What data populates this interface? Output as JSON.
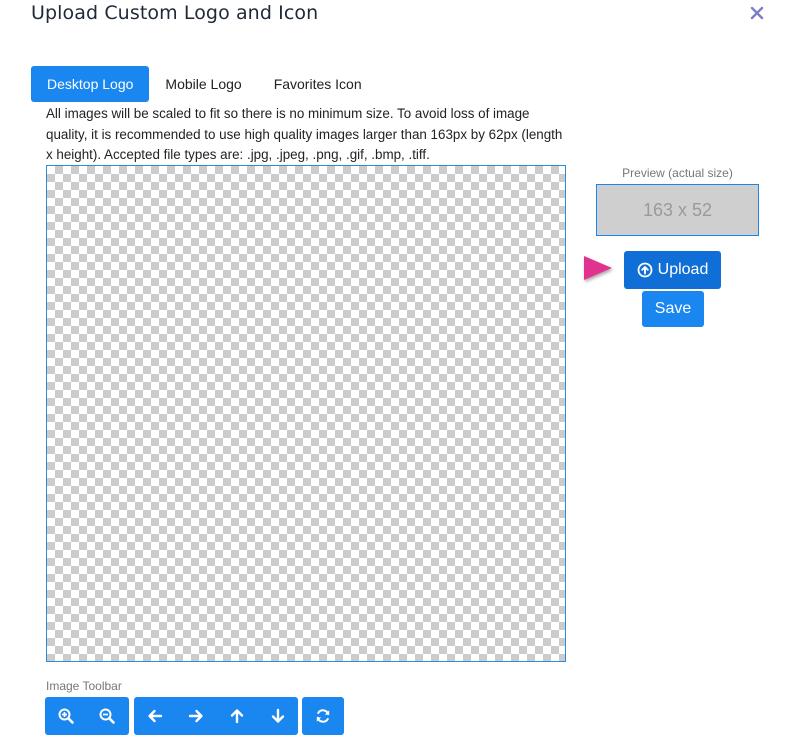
{
  "dialog": {
    "title": "Upload Custom Logo and Icon",
    "close_icon": "close-icon"
  },
  "tabs": [
    {
      "label": "Desktop Logo",
      "active": true
    },
    {
      "label": "Mobile Logo",
      "active": false
    },
    {
      "label": "Favorites Icon",
      "active": false
    }
  ],
  "help_text": "All images will be scaled to fit so there is no minimum size. To avoid loss of image quality, it is recommended to use high quality images larger than 163px by 62px (length x height). Accepted file types are: .jpg, .jpeg, .png, .gif, .bmp, .tiff.",
  "preview": {
    "label": "Preview (actual size)",
    "placeholder": "163 x 52"
  },
  "buttons": {
    "upload_label": "Upload",
    "upload_icon": "upload-circle-icon",
    "save_label": "Save"
  },
  "toolbar": {
    "label": "Image Toolbar",
    "zoom_icons": [
      "zoom-in-icon",
      "zoom-out-icon"
    ],
    "move_icons": [
      "arrow-left-icon",
      "arrow-right-icon",
      "arrow-up-icon",
      "arrow-down-icon"
    ],
    "reset_icon": "refresh-icon"
  },
  "colors": {
    "primary": "#1a86f0",
    "primary_dark": "#0f6fd6",
    "annotation_arrow": "#e0338f"
  }
}
